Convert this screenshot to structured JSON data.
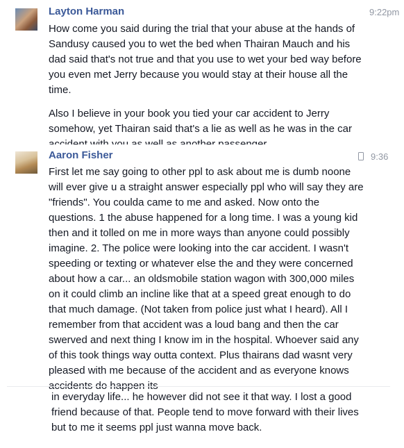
{
  "messages": [
    {
      "sender": "Layton Harman",
      "time": "9:22pm",
      "paragraphs": [
        "How come you said during the trial that your abuse at the hands of Sandusy caused you to wet the bed when Thairan Mauch and his dad said that's not true and that you use to wet your bed way before you even met Jerry because you would stay at their house all the time.",
        "Also I believe in your book you tied your car accident to Jerry somehow, yet Thairan said that's a lie as well as he was in the car accident with you as well as another passenger."
      ]
    },
    {
      "sender": "Aaron Fisher",
      "time": "9:36",
      "sent_from": "mobile-phone-icon",
      "paragraphs": [
        "First let me say going to other ppl to ask about me is dumb noone will ever give u a straight answer especially ppl who will say they are \"friends\". You coulda came to me and asked. Now onto the questions. 1 the abuse happened for a long time. I was a young kid then and it tolled on me in more ways than anyone could possibly imagine. 2. The police were looking into the car accident. I wasn't speeding or texting or whatever else the and they were concerned about how a car... an oldsmobile station wagon with 300,000 miles on it could climb an incline like that at a speed great enough to do that much damage. (Not taken from police just what I heard). All I remember from that accident was a loud  bang and then the car swerved and next thing I know im in the hospital. Whoever said any of this took things way outta context. Plus thairans dad wasnt very pleased with me because of the accident and as everyone knows accidents do happen its",
        "in everyday life... he however did not see it that way. I lost a good friend because of that. People tend to move forward with their lives but to me it seems ppl just wanna move back."
      ]
    }
  ]
}
